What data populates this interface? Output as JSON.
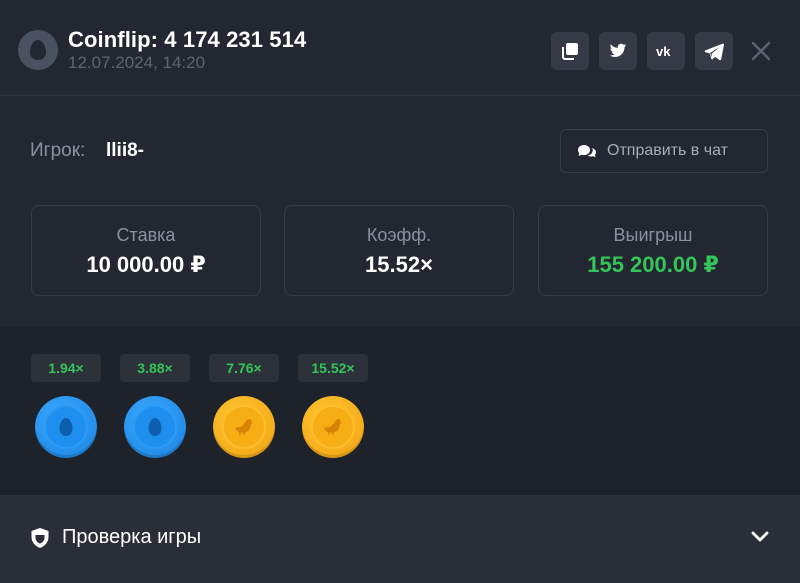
{
  "header": {
    "title": "Coinflip: 4 174 231 514",
    "date": "12.07.2024, 14:20",
    "buttons": [
      "copy-icon",
      "twitter-icon",
      "vk-icon",
      "telegram-icon"
    ],
    "close_icon": "close-icon"
  },
  "player": {
    "label": "Игрок:",
    "name": "llii8-",
    "chat_button": "Отправить в чат"
  },
  "stats": [
    {
      "label": "Ставка",
      "value": "10 000.00 ₽"
    },
    {
      "label": "Коэфф.",
      "value": "15.52×"
    },
    {
      "label": "Выигрыш",
      "value": "155 200.00 ₽"
    }
  ],
  "rounds": [
    {
      "multiplier": "1.94×",
      "side": "blue-egg"
    },
    {
      "multiplier": "3.88×",
      "side": "blue-egg"
    },
    {
      "multiplier": "7.76×",
      "side": "gold-chicken"
    },
    {
      "multiplier": "15.52×",
      "side": "gold-chicken"
    }
  ],
  "verify": {
    "label": "Проверка игры"
  },
  "colors": {
    "accent_green": "#35c45a",
    "coin_blue": "#1e8fee",
    "coin_gold": "#f7ad14"
  }
}
